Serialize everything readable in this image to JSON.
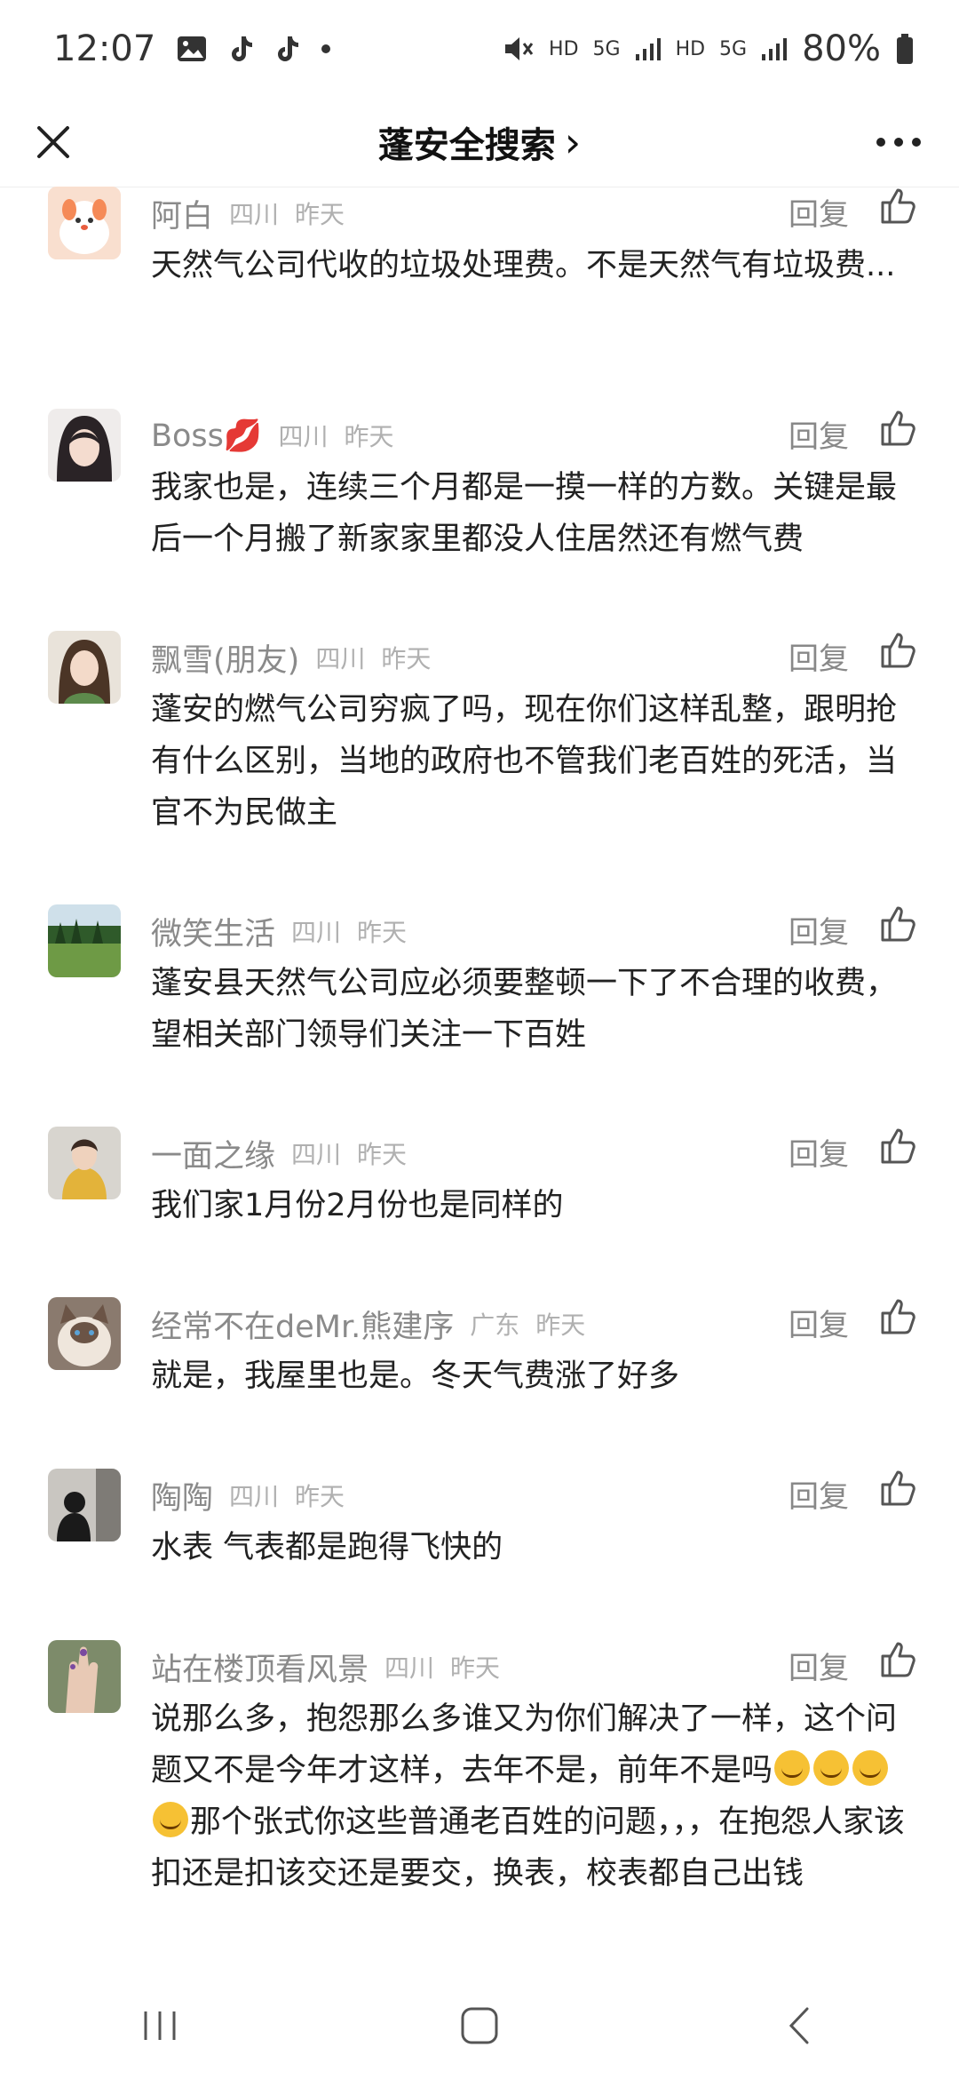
{
  "status_bar": {
    "time": "12:07",
    "network_1": "HD",
    "network_2": "5G",
    "network_3": "HD",
    "network_4": "5G",
    "battery": "80%"
  },
  "nav": {
    "title": "蓬安全搜索",
    "title_arrow": "›"
  },
  "comments": [
    {
      "name": "阿白",
      "location": "四川",
      "time": "昨天",
      "reply_label": "回复",
      "text": "天然气公司代收的垃圾处理费。不是天然气有垃圾费...",
      "avatar_color": "#f5a36b"
    },
    {
      "name": "Boss💋",
      "location": "四川",
      "time": "昨天",
      "reply_label": "回复",
      "text": "我家也是，连续三个月都是一摸一样的方数。关键是最后一个月搬了新家家里都没人住居然还有燃气费",
      "avatar_color": "#3a3236"
    },
    {
      "name": "飘雪(朋友)",
      "location": "四川",
      "time": "昨天",
      "reply_label": "回复",
      "text": "蓬安的燃气公司穷疯了吗，现在你们这样乱整，跟明抢有什么区别，当地的政府也不管我们老百姓的死活，当官不为民做主",
      "avatar_color": "#6a8c5b"
    },
    {
      "name": "微笑生活",
      "location": "四川",
      "time": "昨天",
      "reply_label": "回复",
      "text": "蓬安县天然气公司应必须要整顿一下了不合理的收费，望相关部门领导们关注一下百姓",
      "avatar_color": "#4e7f3d"
    },
    {
      "name": "一面之缘",
      "location": "四川",
      "time": "昨天",
      "reply_label": "回复",
      "text": "我们家1月份2月份也是同样的",
      "avatar_color": "#d9a640"
    },
    {
      "name": "经常不在⁠⁠deMr.熊建序",
      "location": "广东",
      "time": "昨天",
      "reply_label": "回复",
      "text": "就是，我屋里也是。冬天气费涨了好多",
      "avatar_color": "#b9a79a"
    },
    {
      "name": "陶陶",
      "location": "四川",
      "time": "昨天",
      "reply_label": "回复",
      "text": "水表 气表都是跑得飞快的",
      "avatar_color": "#3d3d3d"
    },
    {
      "name": "站在楼顶看风景",
      "location": "四川",
      "time": "昨天",
      "reply_label": "回复",
      "text_part1": "说那么多，抱怨那么多谁又为你们解决了一样，这个问题又不是今年才这样，去年不是，前年不是吗",
      "text_part2": "那个张式你这些普通老百姓的问题，，，在抱怨人家该扣还是扣该交还是要交，换表，校表都自己出钱",
      "avatar_color": "#8f8a7c"
    }
  ]
}
